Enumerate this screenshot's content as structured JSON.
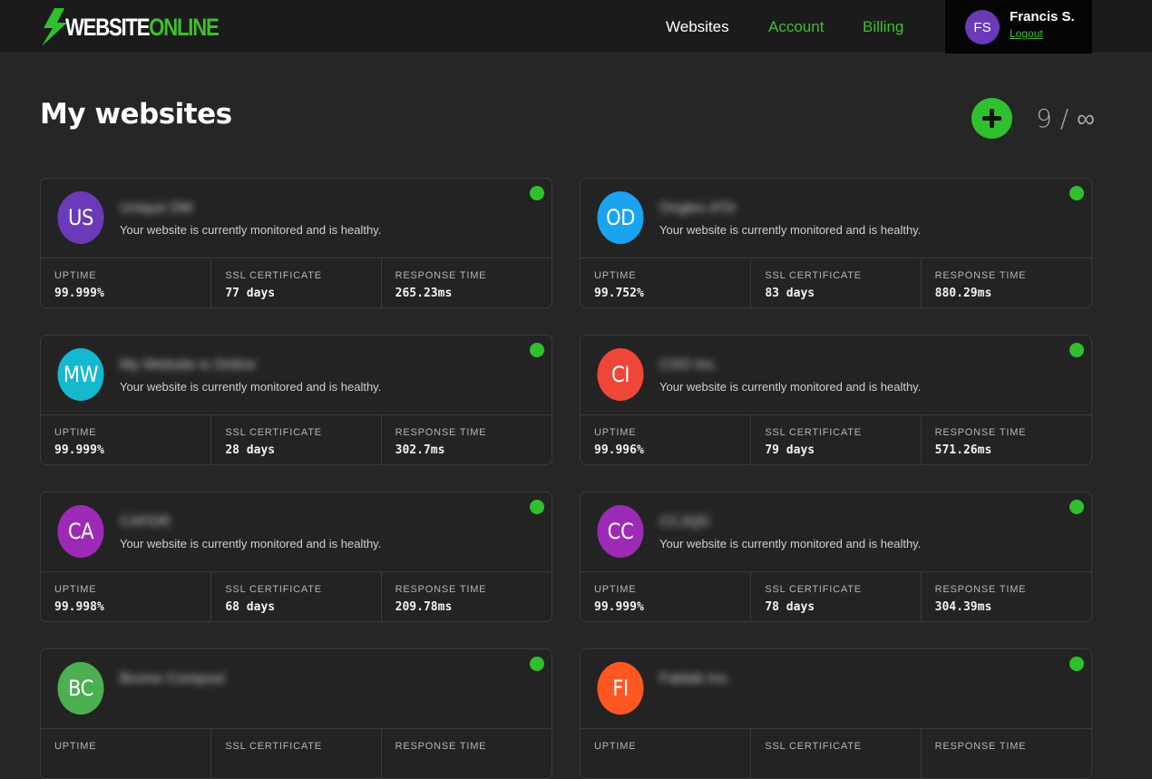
{
  "header": {
    "logo": {
      "part1": "WEBSITE",
      "part2": "ONLINE"
    },
    "nav": [
      {
        "label": "Websites"
      },
      {
        "label": "Account"
      },
      {
        "label": "Billing"
      }
    ],
    "user": {
      "initials": "FS",
      "name": "Francis S.",
      "logout": "Logout"
    }
  },
  "main": {
    "title": "My websites",
    "count": "9 / ∞"
  },
  "stat_labels": {
    "uptime": "UPTIME",
    "ssl": "SSL CERTIFICATE",
    "response": "RESPONSE TIME"
  },
  "colors": {
    "accent": "#2fbf2f",
    "background": "#262626",
    "header": "#1b1b1b"
  },
  "sites": [
    {
      "initials": "US",
      "color": "#6a3ab8",
      "name": "Unique DM",
      "status": "Your website is currently monitored and is healthy.",
      "uptime": "99.999%",
      "ssl": "77 days",
      "response": "265.23ms"
    },
    {
      "initials": "OD",
      "color": "#1aa3f0",
      "name": "Ongles d'Or",
      "status": "Your website is currently monitored and is healthy.",
      "uptime": "99.752%",
      "ssl": "83 days",
      "response": "880.29ms"
    },
    {
      "initials": "MW",
      "color": "#14b8cf",
      "name": "My Website is Online",
      "status": "Your website is currently monitored and is healthy.",
      "uptime": "99.999%",
      "ssl": "28 days",
      "response": "302.7ms"
    },
    {
      "initials": "CI",
      "color": "#ef4638",
      "name": "CSO Inc.",
      "status": "Your website is currently monitored and is healthy.",
      "uptime": "99.996%",
      "ssl": "79 days",
      "response": "571.26ms"
    },
    {
      "initials": "CA",
      "color": "#9c2ab6",
      "name": "CAPDR",
      "status": "Your website is currently monitored and is healthy.",
      "uptime": "99.998%",
      "ssl": "68 days",
      "response": "209.78ms"
    },
    {
      "initials": "CC",
      "color": "#9c2ab6",
      "name": "CCJQD",
      "status": "Your website is currently monitored and is healthy.",
      "uptime": "99.999%",
      "ssl": "78 days",
      "response": "304.39ms"
    },
    {
      "initials": "BC",
      "color": "#4caf50",
      "name": "Brome Compost",
      "status": "",
      "uptime": "",
      "ssl": "",
      "response": ""
    },
    {
      "initials": "FI",
      "color": "#ff5722",
      "name": "Fablab Inc.",
      "status": "",
      "uptime": "",
      "ssl": "",
      "response": ""
    }
  ]
}
